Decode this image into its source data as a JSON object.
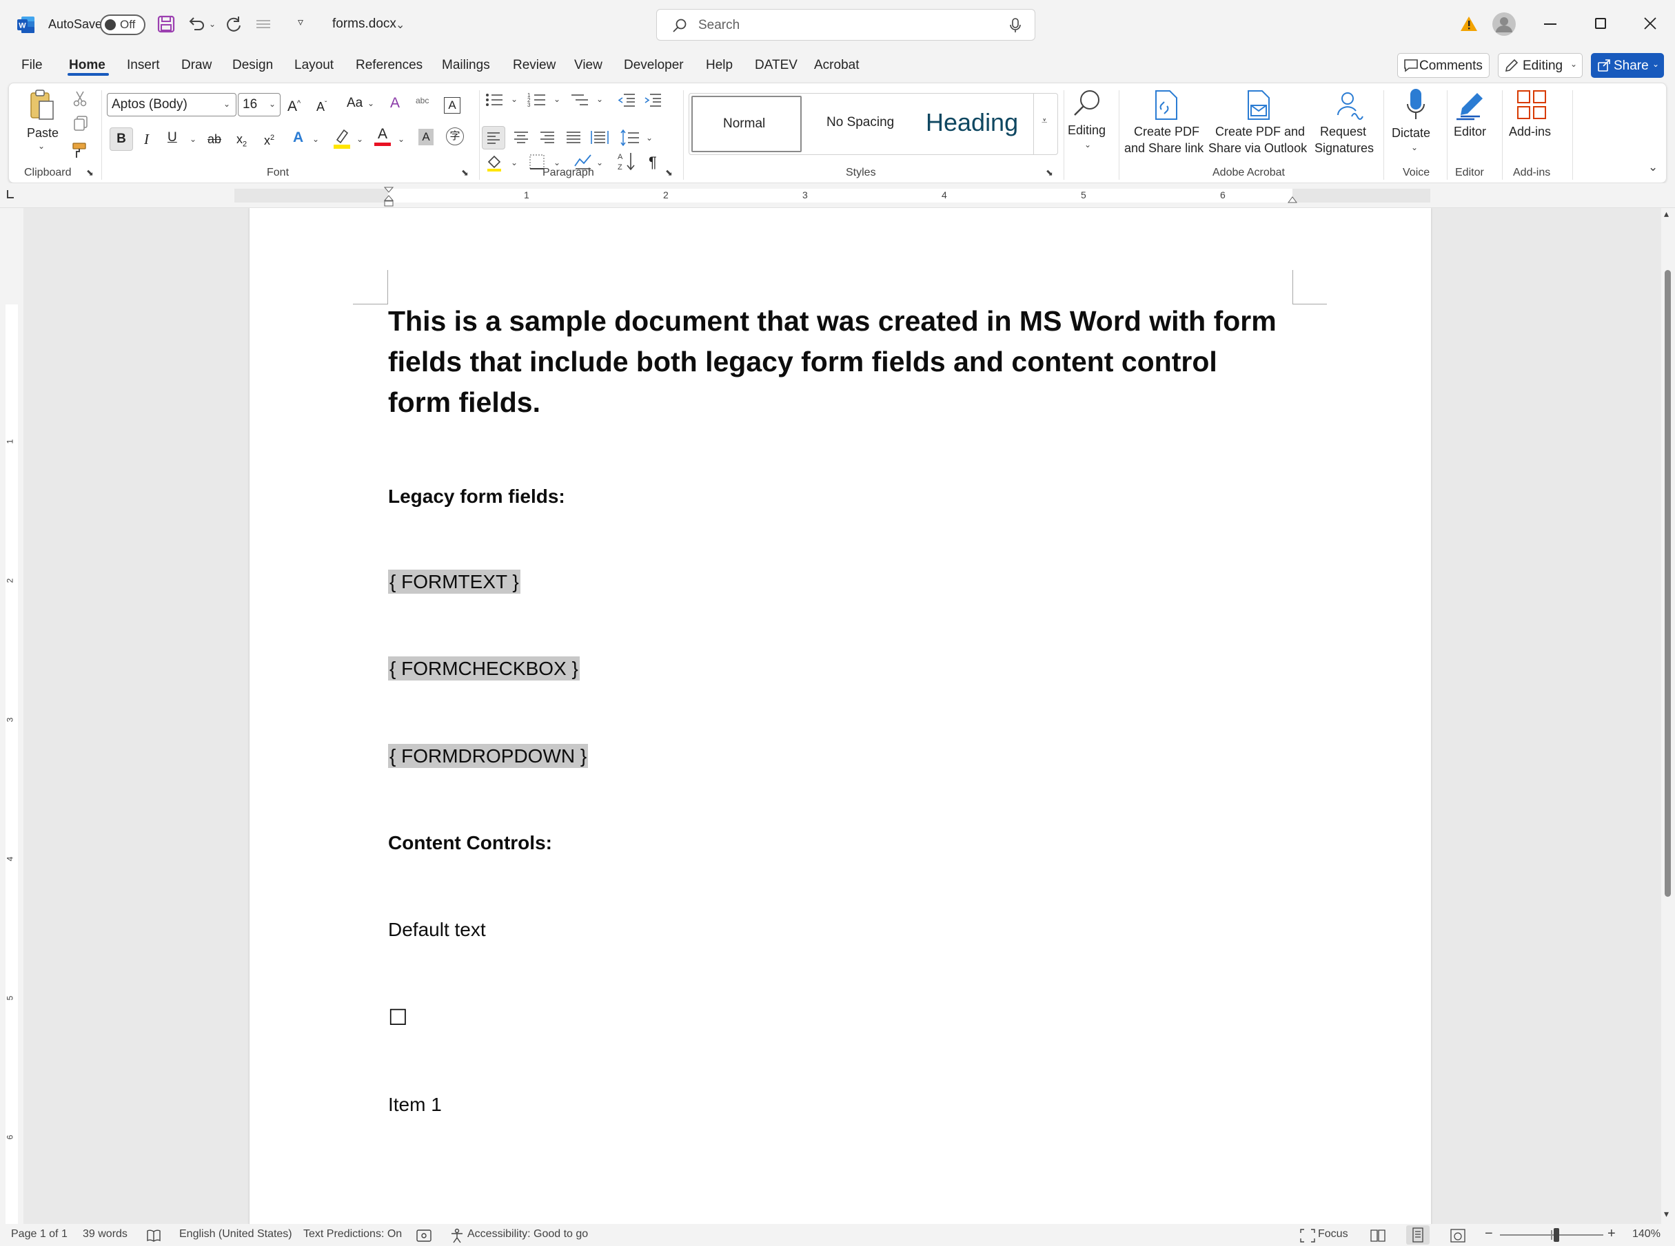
{
  "titlebar": {
    "autosave_label": "AutoSave",
    "autosave_state": "Off",
    "filename": "forms.docx",
    "search_placeholder": "Search"
  },
  "menu": {
    "tabs": [
      "File",
      "Home",
      "Insert",
      "Draw",
      "Design",
      "Layout",
      "References",
      "Mailings",
      "Review",
      "View",
      "Developer",
      "Help",
      "DATEV",
      "Acrobat"
    ],
    "active": "Home",
    "comments": "Comments",
    "editing": "Editing",
    "share": "Share"
  },
  "ribbon": {
    "clipboard": {
      "paste": "Paste",
      "label": "Clipboard"
    },
    "font": {
      "name": "Aptos (Body)",
      "size": "16",
      "label": "Font"
    },
    "paragraph": {
      "label": "Paragraph"
    },
    "styles": {
      "normal": "Normal",
      "no_spacing": "No Spacing",
      "heading": "Heading",
      "label": "Styles"
    },
    "editing": {
      "label": "Editing"
    },
    "acrobat": {
      "create_pdf_share_1": "Create PDF",
      "create_pdf_share_2": "and Share link",
      "create_pdf_outlook_1": "Create PDF and",
      "create_pdf_outlook_2": "Share via Outlook",
      "request_sig_1": "Request",
      "request_sig_2": "Signatures",
      "label": "Adobe Acrobat"
    },
    "voice": {
      "dictate": "Dictate",
      "label": "Voice"
    },
    "editor": {
      "editor": "Editor",
      "label": "Editor"
    },
    "addins": {
      "addins": "Add-ins",
      "label": "Add-ins"
    }
  },
  "ruler": {
    "numbers": [
      "1",
      "2",
      "3",
      "4",
      "5",
      "6"
    ],
    "vnumbers": [
      "1",
      "2",
      "3",
      "4",
      "5",
      "6"
    ]
  },
  "document": {
    "title": "This is a sample document that was created in MS Word with form fields that include both legacy form fields and content control form fields.",
    "legacy_heading": "Legacy form fields:",
    "formtext": "{ FORMTEXT }",
    "formcheckbox": "{ FORMCHECKBOX }",
    "formdropdown": "{ FORMDROPDOWN }",
    "content_heading": "Content Controls:",
    "default_text": "Default text",
    "checkbox_glyph": "☐",
    "item1": "Item 1"
  },
  "status": {
    "page": "Page 1 of 1",
    "words": "39 words",
    "language": "English (United States)",
    "predictions": "Text Predictions: On",
    "accessibility": "Accessibility: Good to go",
    "focus": "Focus",
    "zoom": "140%"
  },
  "colors": {
    "accent": "#185abd",
    "word_blue": "#2b579a",
    "field_shade": "#c8c8c8",
    "save_purple": "#9b3fb0"
  }
}
